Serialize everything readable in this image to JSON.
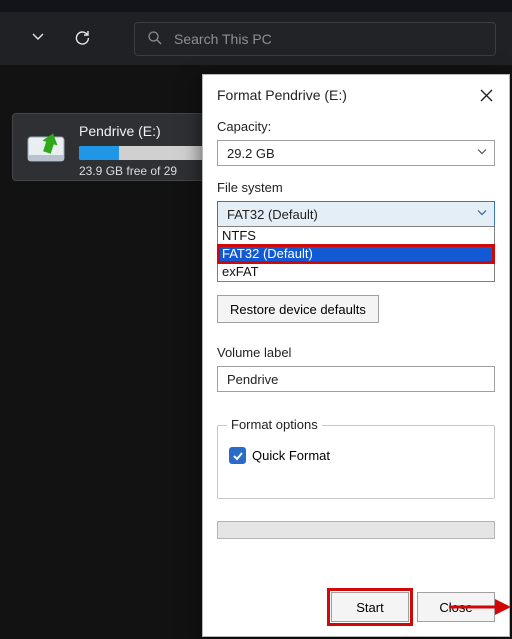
{
  "toolbar": {
    "search_placeholder": "Search This PC"
  },
  "drive": {
    "name": "Pendrive (E:)",
    "free_text": "23.9 GB free of 29"
  },
  "dialog": {
    "title": "Format Pendrive (E:)",
    "capacity_label": "Capacity:",
    "capacity_value": "29.2 GB",
    "filesystem_label": "File system",
    "filesystem_value": "FAT32 (Default)",
    "filesystem_options": {
      "ntfs": "NTFS",
      "fat32": "FAT32 (Default)",
      "exfat": "exFAT"
    },
    "restore_label": "Restore device defaults",
    "volume_label_label": "Volume label",
    "volume_label_value": "Pendrive",
    "format_options_label": "Format options",
    "quick_format_label": "Quick Format",
    "start_label": "Start",
    "close_label": "Close"
  }
}
